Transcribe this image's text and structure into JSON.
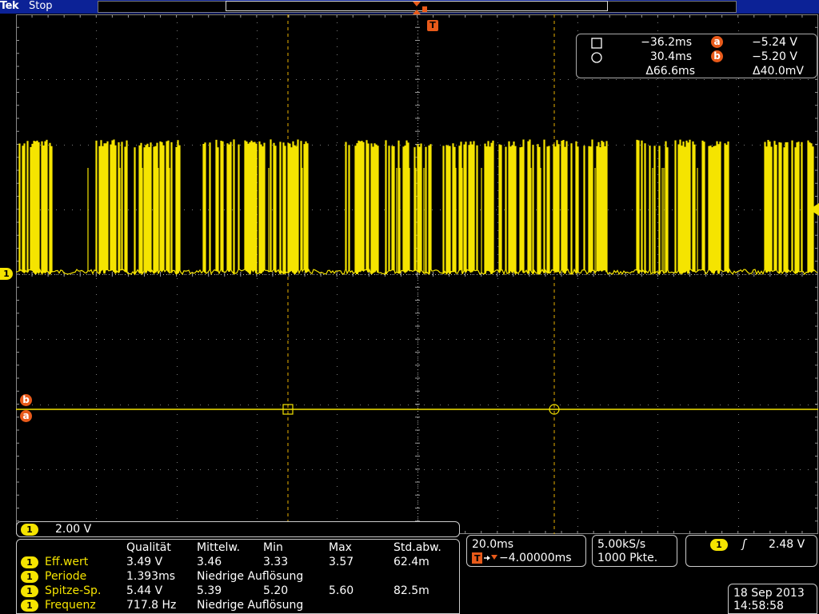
{
  "top": {
    "brand": "Tek",
    "status": "Stop"
  },
  "trigger": {
    "position_marker": "T"
  },
  "channel": {
    "label": "1",
    "scale": "2.00 V"
  },
  "cursors": {
    "a_label": "a",
    "b_label": "b",
    "row1": {
      "time": "−36.2ms",
      "volt": "−5.24 V"
    },
    "row2": {
      "time": "30.4ms",
      "volt": "−5.20 V"
    },
    "delta": {
      "time": "Δ66.6ms",
      "volt": "Δ40.0mV"
    }
  },
  "measurements": {
    "headers": [
      "Qualität",
      "Mittelw.",
      "Min",
      "Max",
      "Std.abw."
    ],
    "rows": [
      {
        "name": "Eff.wert",
        "value": "3.49 V",
        "cells": [
          "3.46",
          "3.33",
          "3.57",
          "62.4m"
        ]
      },
      {
        "name": "Periode",
        "value": "1.393ms",
        "cells": [
          "Niedrige Auflösung",
          "",
          "",
          ""
        ]
      },
      {
        "name": "Spitze-Sp.",
        "value": "5.44 V",
        "cells": [
          "5.39",
          "5.20",
          "5.60",
          "82.5m"
        ]
      },
      {
        "name": "Frequenz",
        "value": "717.8 Hz",
        "cells": [
          "Niedrige Auflösung",
          "",
          "",
          ""
        ]
      }
    ]
  },
  "horizontal": {
    "scale": "20.0ms",
    "delay": "−4.00000ms"
  },
  "acquisition": {
    "rate": "5.00kS/s",
    "points": "1000 Pkte."
  },
  "trigger_info": {
    "channel": "1",
    "slope": "ʃ",
    "level": "2.48 V"
  },
  "datetime": {
    "date": "18 Sep 2013",
    "time": "14:58:58"
  },
  "colors": {
    "trace": "#f5e400",
    "cursor": "#e8b000",
    "marker": "#e85a1a",
    "topbar": "#0c2296"
  }
}
